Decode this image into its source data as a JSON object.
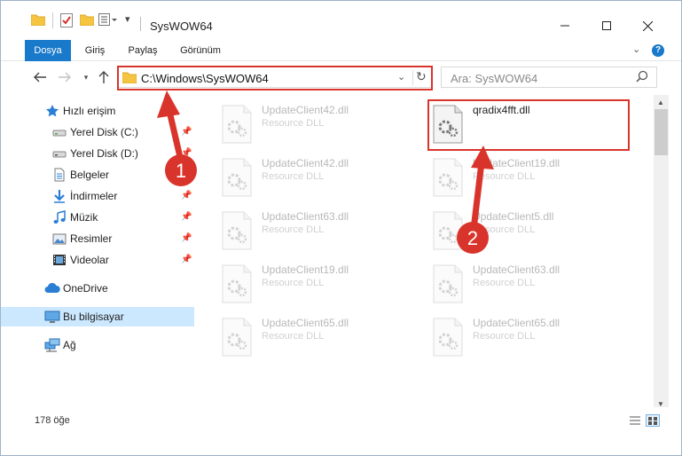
{
  "window": {
    "title": "SysWOW64"
  },
  "ribbon": {
    "tabs": [
      {
        "label": "Dosya",
        "active": true
      },
      {
        "label": "Giriş",
        "active": false
      },
      {
        "label": "Paylaş",
        "active": false
      },
      {
        "label": "Görünüm",
        "active": false
      }
    ],
    "help_label": "?"
  },
  "address": {
    "path": "C:\\Windows\\SysWOW64"
  },
  "search": {
    "placeholder": "Ara: SysWOW64"
  },
  "sidebar": {
    "items": [
      {
        "label": "Hızlı erişim",
        "icon": "star-icon",
        "pinned": false
      },
      {
        "label": "Yerel Disk (C:)",
        "icon": "drive-icon",
        "pinned": true
      },
      {
        "label": "Yerel Disk (D:)",
        "icon": "drive-icon",
        "pinned": true
      },
      {
        "label": "Belgeler",
        "icon": "documents-icon",
        "pinned": true
      },
      {
        "label": "İndirmeler",
        "icon": "download-icon",
        "pinned": true
      },
      {
        "label": "Müzik",
        "icon": "music-icon",
        "pinned": true
      },
      {
        "label": "Resimler",
        "icon": "pictures-icon",
        "pinned": true
      },
      {
        "label": "Videolar",
        "icon": "video-icon",
        "pinned": true
      },
      {
        "label": "OneDrive",
        "icon": "cloud-icon",
        "pinned": false
      },
      {
        "label": "Bu bilgisayar",
        "icon": "computer-icon",
        "pinned": false,
        "selected": true
      },
      {
        "label": "Ağ",
        "icon": "network-icon",
        "pinned": false
      }
    ]
  },
  "files": [
    {
      "name": "UpdateClient42.dll",
      "type": "Resource DLL",
      "faded": true
    },
    {
      "name": "qradix4fft.dll",
      "type": "",
      "faded": false,
      "highlighted": true
    },
    {
      "name": "UpdateClient42.dll",
      "type": "Resource DLL",
      "faded": true
    },
    {
      "name": "UpdateClient19.dll",
      "type": "Resource DLL",
      "faded": true
    },
    {
      "name": "UpdateClient63.dll",
      "type": "Resource DLL",
      "faded": true
    },
    {
      "name": "UpdateClient5.dll",
      "type": "Resource DLL",
      "faded": true
    },
    {
      "name": "UpdateClient19.dll",
      "type": "Resource DLL",
      "faded": true
    },
    {
      "name": "UpdateClient63.dll",
      "type": "Resource DLL",
      "faded": true
    },
    {
      "name": "UpdateClient65.dll",
      "type": "Resource DLL",
      "faded": true
    },
    {
      "name": "UpdateClient65.dll",
      "type": "Resource DLL",
      "faded": true
    }
  ],
  "status": {
    "item_count": "178 öğe"
  },
  "annotations": [
    {
      "number": "1",
      "color": "#d9342b"
    },
    {
      "number": "2",
      "color": "#d9342b"
    }
  ],
  "colors": {
    "accent": "#1979ca",
    "annotation": "#d9342b",
    "selection": "#cce8ff"
  }
}
